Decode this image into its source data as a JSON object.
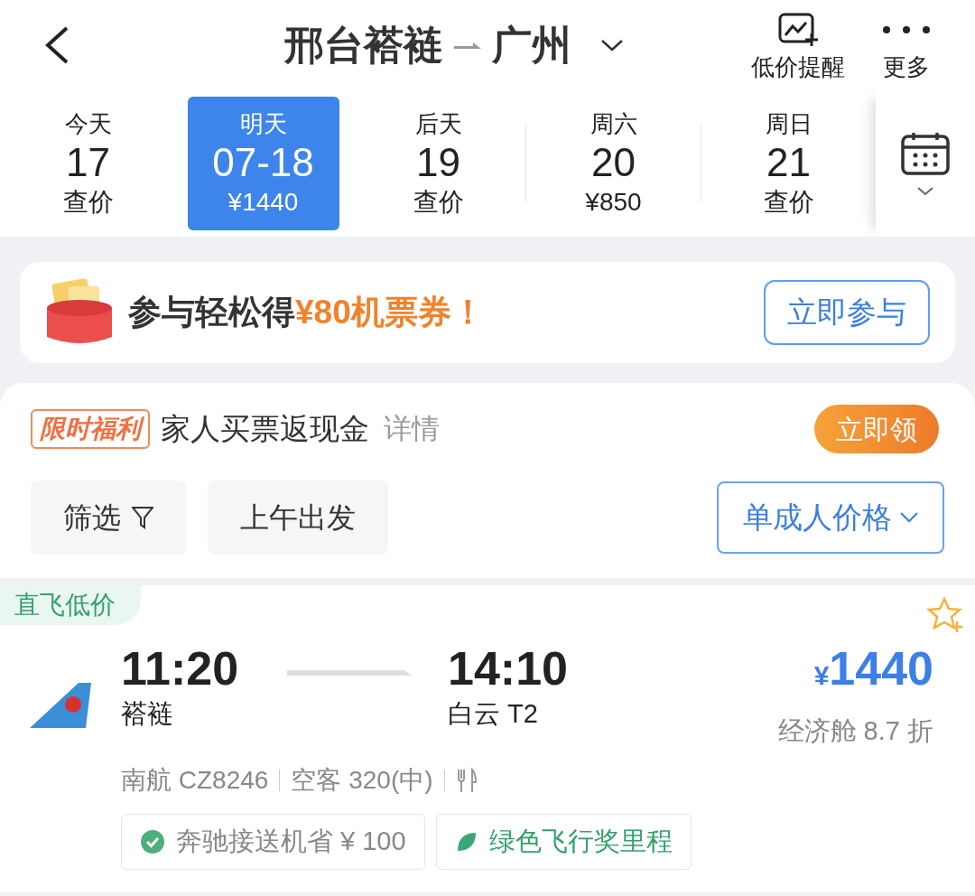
{
  "header": {
    "from": "邢台褡裢",
    "to": "广州",
    "actions": [
      {
        "kind": "alert",
        "label": "低价提醒"
      },
      {
        "kind": "more",
        "label": "更多"
      }
    ]
  },
  "dates": [
    {
      "day": "今天",
      "date": "17",
      "price": "查价",
      "selected": false
    },
    {
      "day": "明天",
      "date": "07-18",
      "price": "¥1440",
      "selected": true
    },
    {
      "day": "后天",
      "date": "19",
      "price": "查价",
      "selected": false
    },
    {
      "day": "周六",
      "date": "20",
      "price": "¥850",
      "selected": false
    },
    {
      "day": "周日",
      "date": "21",
      "price": "查价",
      "selected": false
    }
  ],
  "promo": {
    "lead": "参与轻松得",
    "highlight": "¥80机票券！",
    "button": "立即参与"
  },
  "benefit": {
    "badge": "限时福利",
    "text": "家人买票返现金",
    "link": "详情",
    "button": "立即领"
  },
  "filters": [
    {
      "kind": "filter",
      "label": "筛选"
    },
    {
      "kind": "plain",
      "label": "上午出发"
    }
  ],
  "price_mode": "单成人价格",
  "flight": {
    "tag": "直飞低价",
    "dep_time": "11:20",
    "dep_airport": "褡裢",
    "arr_time": "14:10",
    "arr_airport": "白云 T2",
    "currency": "¥",
    "price": "1440",
    "cabin": "经济舱 8.7 折",
    "flight_no": "南航 CZ8246",
    "aircraft": "空客 320(中)",
    "perks": [
      {
        "kind": "check",
        "label": "奔驰接送机省 ¥ 100"
      },
      {
        "kind": "leaf",
        "label": "绿色飞行奖里程"
      }
    ]
  }
}
